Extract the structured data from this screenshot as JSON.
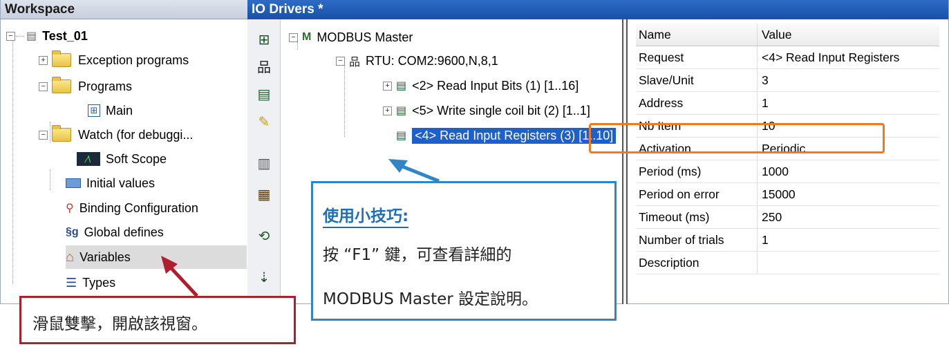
{
  "workspace": {
    "title": "Workspace",
    "root": "Test_01",
    "items": [
      {
        "label": "Exception programs"
      },
      {
        "label": "Programs"
      },
      {
        "label": "Main"
      },
      {
        "label": "Watch (for debuggi..."
      },
      {
        "label": "Soft Scope"
      },
      {
        "label": "Initial values"
      },
      {
        "label": "Binding Configuration"
      },
      {
        "label": "Global defines"
      },
      {
        "label": "Variables"
      },
      {
        "label": "Types"
      }
    ]
  },
  "io": {
    "title": "IO Drivers *",
    "tree": {
      "master": "MODBUS Master",
      "port": "RTU: COM2:9600,N,8,1",
      "items": [
        "<2> Read Input Bits (1) [1..16]",
        "<5> Write single coil bit (2) [1..1]",
        "<4> Read Input Registers (3) [1..10]"
      ]
    },
    "toolbar_icons": [
      "tree-icon",
      "network-icon",
      "add-item-icon",
      "insert-icon",
      "table-icon",
      "table-edit-icon",
      "link-icon",
      "move-down-icon"
    ]
  },
  "properties": {
    "header": {
      "name": "Name",
      "value": "Value"
    },
    "rows": [
      {
        "name": "Request",
        "value": "<4> Read Input Registers"
      },
      {
        "name": "Slave/Unit",
        "value": "3"
      },
      {
        "name": "Address",
        "value": "1"
      },
      {
        "name": "Nb Item",
        "value": "10"
      },
      {
        "name": "Activation",
        "value": "Periodic"
      },
      {
        "name": "Period (ms)",
        "value": "1000"
      },
      {
        "name": "Period on error",
        "value": "15000"
      },
      {
        "name": "Timeout (ms)",
        "value": "250"
      },
      {
        "name": "Number of trials",
        "value": "1"
      },
      {
        "name": "Description",
        "value": ""
      }
    ]
  },
  "callouts": {
    "tip_title": "使用小技巧:",
    "tip_line1": "按 “F1” 鍵，可查看詳細的",
    "tip_line2": "MODBUS Master 設定說明。",
    "hint": "滑鼠雙擊，開啟該視窗。"
  },
  "colors": {
    "tip_border": "#2e86c8",
    "hint_border": "#b01e2e",
    "highlight": "#f07a20",
    "selection": "#1f5fc9"
  }
}
